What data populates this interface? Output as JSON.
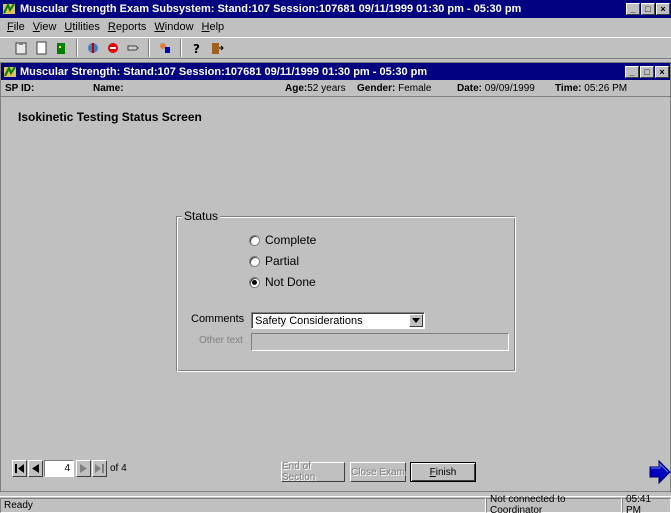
{
  "app": {
    "title": "Muscular Strength Exam Subsystem:  Stand:107  Session:107681  09/11/1999  01:30 pm - 05:30 pm",
    "window_controls": [
      "_",
      "□",
      "×"
    ]
  },
  "menu": [
    {
      "underline": "F",
      "rest": "ile"
    },
    {
      "underline": "V",
      "rest": "iew"
    },
    {
      "underline": "U",
      "rest": "tilities"
    },
    {
      "underline": "R",
      "rest": "eports"
    },
    {
      "underline": "W",
      "rest": "indow"
    },
    {
      "underline": "H",
      "rest": "elp"
    }
  ],
  "toolbar": {
    "icons": [
      "clipboard-icon",
      "new-page-icon",
      "exit-door-icon",
      "tools-icon",
      "stop-sign-icon",
      "pointer-icon",
      "people-icon",
      "help-icon",
      "door-exit-icon"
    ]
  },
  "child": {
    "title": "Muscular Strength:  Stand:107  Session:107681  09/11/1999  01:30 pm - 05:30 pm"
  },
  "info": {
    "sp_id_label": "SP ID:",
    "name_label": "Name:",
    "age_label": "Age:",
    "age_value": "52 years",
    "gender_label": "Gender:",
    "gender_value": "Female",
    "date_label": "Date:",
    "date_value": "09/09/1999",
    "time_label": "Time:",
    "time_value": "05:26 PM"
  },
  "screen_title": "Isokinetic Testing Status Screen",
  "status_group": {
    "label": "Status",
    "options": [
      {
        "label": "Complete",
        "checked": false
      },
      {
        "label": "Partial",
        "checked": false
      },
      {
        "label": "Not Done",
        "checked": true
      }
    ],
    "comments_label": "Comments",
    "comments_value": "Safety Considerations",
    "other_text_label": "Other text",
    "other_text_value": ""
  },
  "nav": {
    "page": "4",
    "of_text": "of 4"
  },
  "buttons": {
    "end_of_section": "End of Section",
    "close_exam": "Close Exam",
    "finish_underline": "F",
    "finish_rest": "inish"
  },
  "status_bar": {
    "ready": "Ready",
    "connection": "Not connected to Coordinator",
    "clock": "05:41 PM"
  }
}
